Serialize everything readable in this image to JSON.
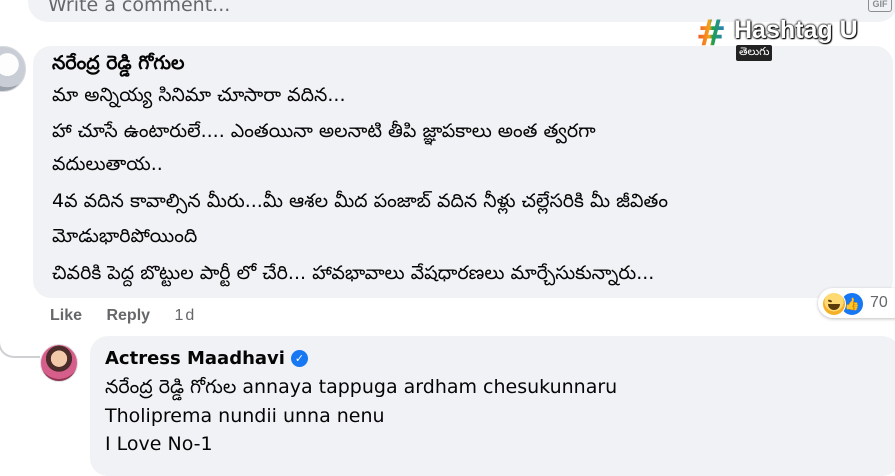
{
  "composer": {
    "placeholder": "Write a comment...",
    "gif_label": "GIF"
  },
  "watermark": {
    "hash": "#",
    "brand": "Hashtag U",
    "sub": "తెలుగు"
  },
  "comment": {
    "author": "నరేంద్ర రెడ్డి గోగుల",
    "lines": [
      "మా అన్నియ్య సినిమా చూసారా వదిన...",
      "హా చూసే ఉంటారులే.... ఎంతయినా అలనాటి తీపి జ్ఞాపకాలు అంత త్వరగా",
      "వదులుతాయ..",
      "4వ వదిన కావాల్సిన మీరు...మీ ఆశల మీద పంజాబ్ వదిన నీళ్లు చల్లేసరికి మీ జీవితం",
      "మోడుభారిపోయింది",
      "చివరికి పెద్ద బొట్టుల పార్టీ లో చేరి... హావభావాలు వేషధారణలు మార్చేసుకున్నారు..."
    ],
    "reaction_count": "70",
    "actions": {
      "like": "Like",
      "reply": "Reply",
      "time": "1d"
    }
  },
  "reply": {
    "author": "Actress Maadhavi",
    "lines": [
      "నరేంద్ర రెడ్డి గోగుల annaya tappuga ardham chesukunnaru",
      "Tholiprema nundii unna nenu",
      "I Love No-1"
    ]
  }
}
